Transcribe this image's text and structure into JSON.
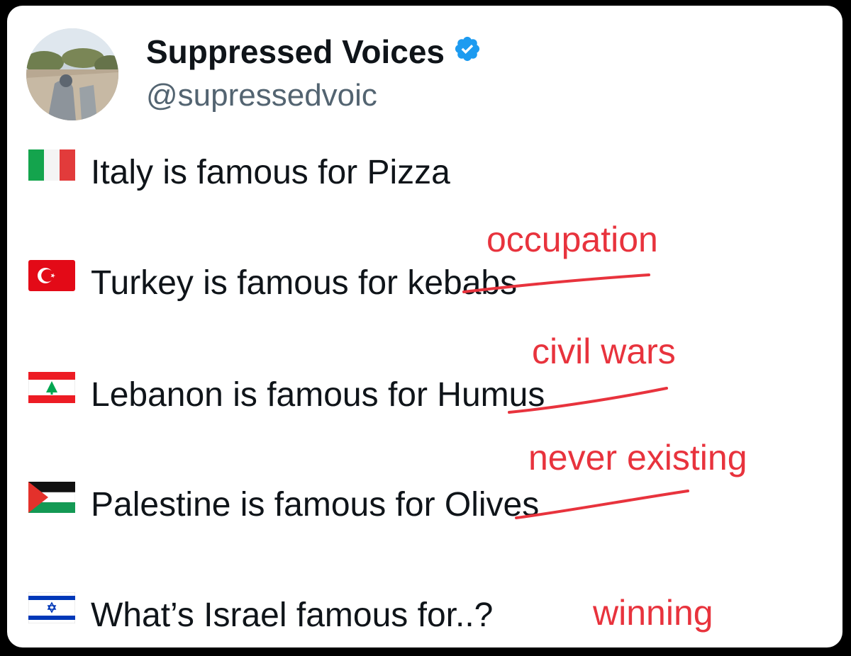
{
  "author": {
    "display_name": "Suppressed Voices",
    "handle": "@supressedvoic",
    "verified_icon": "verified-badge-icon"
  },
  "lines": [
    {
      "flag": "italy-flag-icon",
      "text": "Italy is famous for Pizza"
    },
    {
      "flag": "turkey-flag-icon",
      "text": "Turkey is famous for kebabs"
    },
    {
      "flag": "lebanon-flag-icon",
      "text": "Lebanon is famous for Humus"
    },
    {
      "flag": "palestine-flag-icon",
      "text": "Palestine is famous for Olives"
    },
    {
      "flag": "israel-flag-icon",
      "text": "What’s Israel famous for..?"
    }
  ],
  "annotations": [
    "occupation",
    "civil wars",
    "never existing",
    "winning"
  ],
  "colors": {
    "annotation": "#e8333d",
    "verified": "#1d9bf0",
    "text": "#0f1419",
    "handle": "#536471"
  }
}
